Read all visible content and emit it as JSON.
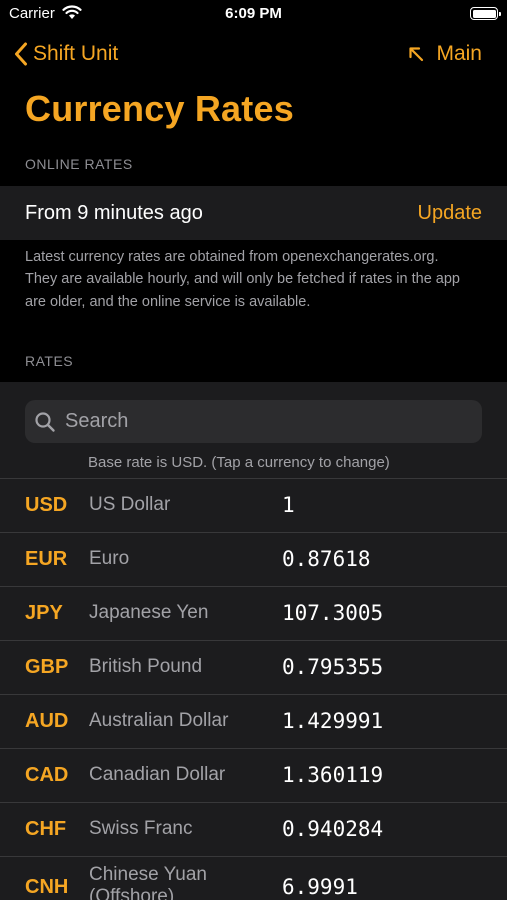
{
  "status_bar": {
    "carrier": "Carrier",
    "time": "6:09 PM"
  },
  "nav": {
    "back_label": "Shift Unit",
    "main_label": "Main"
  },
  "title": "Currency Rates",
  "online_section": {
    "header": "ONLINE RATES",
    "updated_text": "From 9 minutes ago",
    "update_label": "Update",
    "footer": "Latest currency rates are obtained from openexchangerates.org. They are available hourly, and will only be fetched if rates in the app are older, and the online service is available."
  },
  "rates_section": {
    "header": "RATES",
    "search_placeholder": "Search",
    "base_note": "Base rate is USD. (Tap a currency to change)",
    "rates": [
      {
        "code": "USD",
        "name": "US Dollar",
        "value": "1"
      },
      {
        "code": "EUR",
        "name": "Euro",
        "value": "0.87618"
      },
      {
        "code": "JPY",
        "name": "Japanese Yen",
        "value": "107.3005"
      },
      {
        "code": "GBP",
        "name": "British Pound",
        "value": "0.795355"
      },
      {
        "code": "AUD",
        "name": "Australian Dollar",
        "value": "1.429991"
      },
      {
        "code": "CAD",
        "name": "Canadian Dollar",
        "value": "1.360119"
      },
      {
        "code": "CHF",
        "name": "Swiss Franc",
        "value": "0.940284"
      },
      {
        "code": "CNH",
        "name": "Chinese Yuan (Offshore)",
        "value": "6.9991"
      }
    ]
  },
  "icons": {
    "back": "chevron-left-icon",
    "main": "arrow-up-left-icon",
    "search": "search-icon",
    "wifi": "wifi-icon",
    "battery": "battery-icon"
  },
  "colors": {
    "accent": "#f5a623",
    "background": "#000000",
    "cell_background": "#1c1c1e",
    "secondary_text": "#a2a2a7"
  }
}
